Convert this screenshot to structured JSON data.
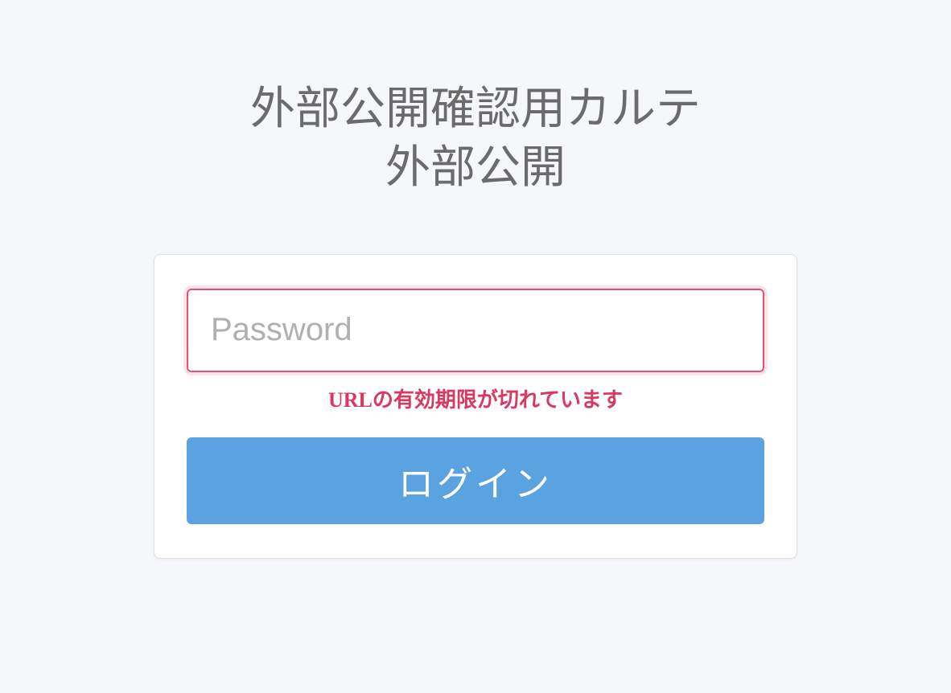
{
  "header": {
    "title_line1": "外部公開確認用カルテ",
    "title_line2": "外部公開"
  },
  "form": {
    "password_placeholder": "Password",
    "password_value": "",
    "error_message": "URLの有効期限が切れています",
    "login_button_label": "ログイン"
  },
  "colors": {
    "background": "#f5f7fa",
    "title_text": "#6b6b6b",
    "error_text": "#d93860",
    "input_border_error": "#e8526f",
    "button_bg": "#5ba3e0",
    "button_text": "#ffffff"
  }
}
